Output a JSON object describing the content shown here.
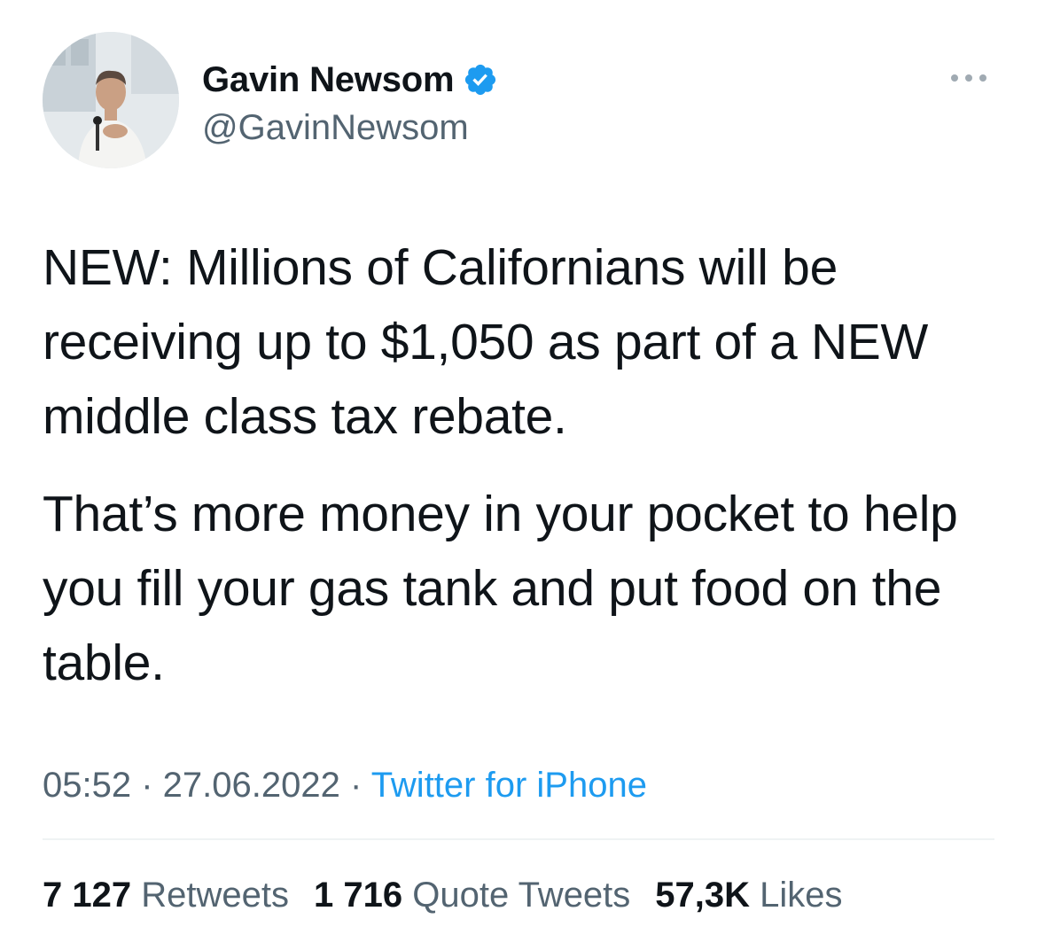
{
  "author": {
    "display_name": "Gavin Newsom",
    "handle": "@GavinNewsom",
    "verified": true,
    "verified_color": "#1d9bf0"
  },
  "tweet": {
    "paragraphs": [
      "NEW: Millions of Californians will be receiving up to $1,050 as part of a NEW middle class tax rebate.",
      "That’s more money in your pocket to help you fill your gas tank and put food on the table."
    ],
    "time": "05:52",
    "separator": " · ",
    "date": "27.06.2022",
    "source": "Twitter for iPhone"
  },
  "stats": {
    "retweets_count": "7 127",
    "retweets_label": "Retweets",
    "quotes_count": "1 716",
    "quotes_label": "Quote Tweets",
    "likes_count": "57,3K",
    "likes_label": "Likes"
  },
  "icons": {
    "more": "more-horizontal-icon",
    "verified": "verified-badge-icon"
  },
  "colors": {
    "text_primary": "#0f1419",
    "text_secondary": "#536471",
    "link": "#1d9bf0",
    "divider": "#eff3f4"
  }
}
